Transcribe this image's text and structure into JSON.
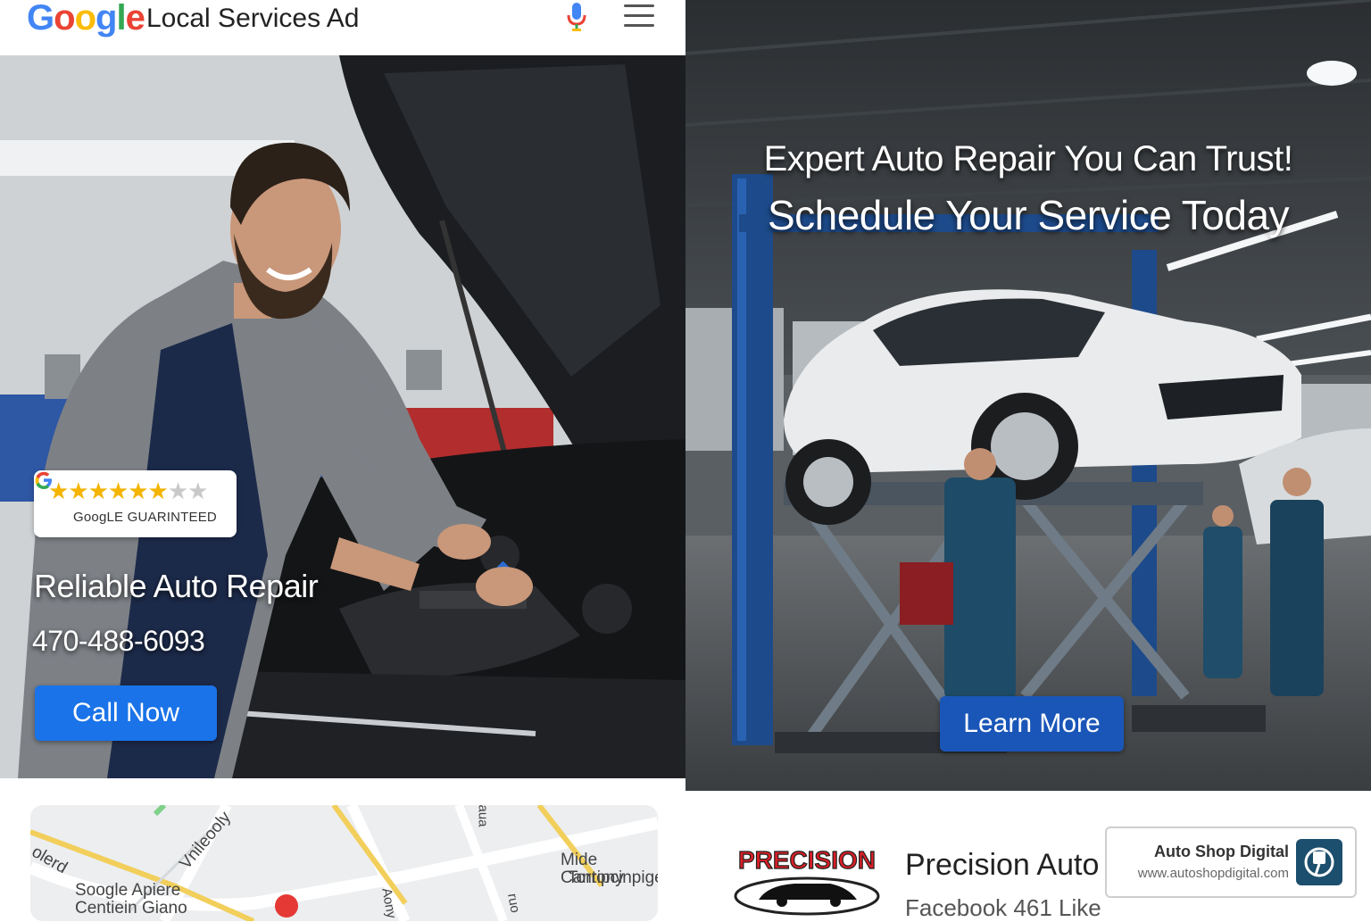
{
  "header": {
    "logo_text": "Google",
    "title": "Local Services Ad",
    "mic_icon": "microphone-icon",
    "menu_icon": "hamburger-menu-icon"
  },
  "left_ad": {
    "badge": {
      "rating_stars": 6.5,
      "rating_out_of": 8,
      "label": "GoogLE GUARINTEED"
    },
    "title": "Reliable Auto Repair",
    "phone": "470-488-6093",
    "cta_label": "Call Now",
    "cta_color": "#1a73e8"
  },
  "map": {
    "labels": [
      "olerd",
      "Vnileooly",
      "Soogle Apiere",
      "Centiein Giano",
      "Mide Cantony",
      "Torripcinpige",
      "aua",
      "Aony",
      "ruo"
    ]
  },
  "right_ad": {
    "headline": "Expert Auto Repair You Can Trust!",
    "subheadline": "Schedule Your Service Today",
    "cta_label": "Learn More",
    "cta_color": "#1a56b8"
  },
  "business": {
    "logo_text": "PRECISION",
    "name": "Precision Auto",
    "subtitle": "Facebook 461 Like"
  },
  "credit": {
    "name": "Auto Shop Digital",
    "url": "www.autoshopdigital.com",
    "icon": "piston-icon"
  },
  "colors": {
    "google_blue": "#4285F4",
    "google_red": "#EA4335",
    "google_yellow": "#FBBC05",
    "google_green": "#34A853",
    "star": "#f4b400"
  }
}
